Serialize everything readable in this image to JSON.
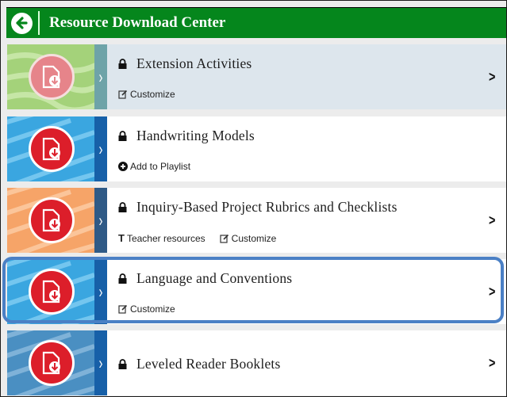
{
  "header": {
    "title": "Resource Download Center",
    "back_icon": "arrow-left-circle-icon"
  },
  "colors": {
    "header_bg": "#05861c",
    "accent_red": "#dc1e2a",
    "selection": "#4b80c5"
  },
  "resources": [
    {
      "title": "Extension Activities",
      "locked": true,
      "theme": "green",
      "tab_color": "#6ea3a8",
      "dimmed": true,
      "actions": [
        {
          "icon": "edit-icon",
          "label": "Customize"
        }
      ],
      "has_chevron": true
    },
    {
      "title": "Handwriting Models",
      "locked": true,
      "theme": "blue",
      "tab_color": "#1760a8",
      "dimmed": false,
      "actions": [
        {
          "icon": "plus-circle-icon",
          "label": "Add to Playlist"
        }
      ],
      "has_chevron": false
    },
    {
      "title": "Inquiry-Based Project Rubrics and Checklists",
      "locked": true,
      "theme": "orange",
      "tab_color": "#2f5a86",
      "dimmed": false,
      "actions": [
        {
          "icon": "text-icon",
          "label": "Teacher resources"
        },
        {
          "icon": "edit-icon",
          "label": "Customize"
        }
      ],
      "has_chevron": true
    },
    {
      "title": "Language and Conventions",
      "locked": true,
      "theme": "blue",
      "tab_color": "#1760a8",
      "dimmed": false,
      "selected": true,
      "actions": [
        {
          "icon": "edit-icon",
          "label": "Customize"
        }
      ],
      "has_chevron": true
    },
    {
      "title": "Leveled Reader Booklets",
      "locked": true,
      "theme": "steel",
      "tab_color": "#1760a8",
      "dimmed": false,
      "actions": [],
      "has_chevron": true
    }
  ]
}
